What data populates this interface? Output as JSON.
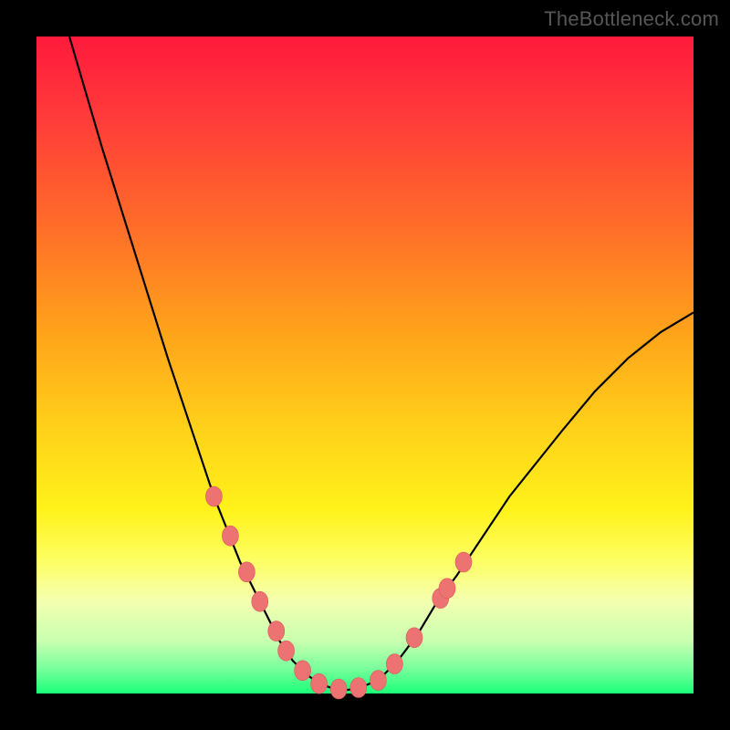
{
  "watermark": "TheBottleneck.com",
  "chart_data": {
    "type": "line",
    "title": "",
    "xlabel": "",
    "ylabel": "",
    "xlim": [
      0,
      100
    ],
    "ylim": [
      0,
      100
    ],
    "curve": {
      "x": [
        5,
        10,
        15,
        20,
        25,
        27,
        29,
        31,
        33,
        35,
        37,
        39,
        41,
        43,
        45,
        47,
        49,
        52,
        55,
        58,
        61,
        64,
        68,
        72,
        76,
        80,
        85,
        90,
        95,
        100
      ],
      "y": [
        100,
        83,
        67,
        51,
        36,
        30,
        25,
        20,
        16,
        12,
        8,
        5,
        3,
        1.5,
        0.8,
        0.5,
        0.8,
        2,
        5,
        9,
        14,
        18,
        24,
        30,
        35,
        40,
        46,
        51,
        55,
        58
      ]
    },
    "series": [
      {
        "name": "bottleneck-dots",
        "x": [
          27.0,
          29.5,
          32.0,
          34.0,
          36.5,
          38.0,
          40.5,
          43.0,
          46.0,
          49.0,
          52.0,
          54.5,
          57.5,
          61.5,
          62.5,
          65.0
        ],
        "y": [
          30.0,
          24.0,
          18.5,
          14.0,
          9.5,
          6.5,
          3.5,
          1.5,
          0.7,
          0.9,
          2.0,
          4.5,
          8.5,
          14.5,
          16.0,
          20.0
        ]
      }
    ],
    "colors": {
      "curve": "#000000",
      "dots": "#ed7272",
      "gradient_top": "#ff1a3c",
      "gradient_bottom": "#1aff7a"
    }
  }
}
